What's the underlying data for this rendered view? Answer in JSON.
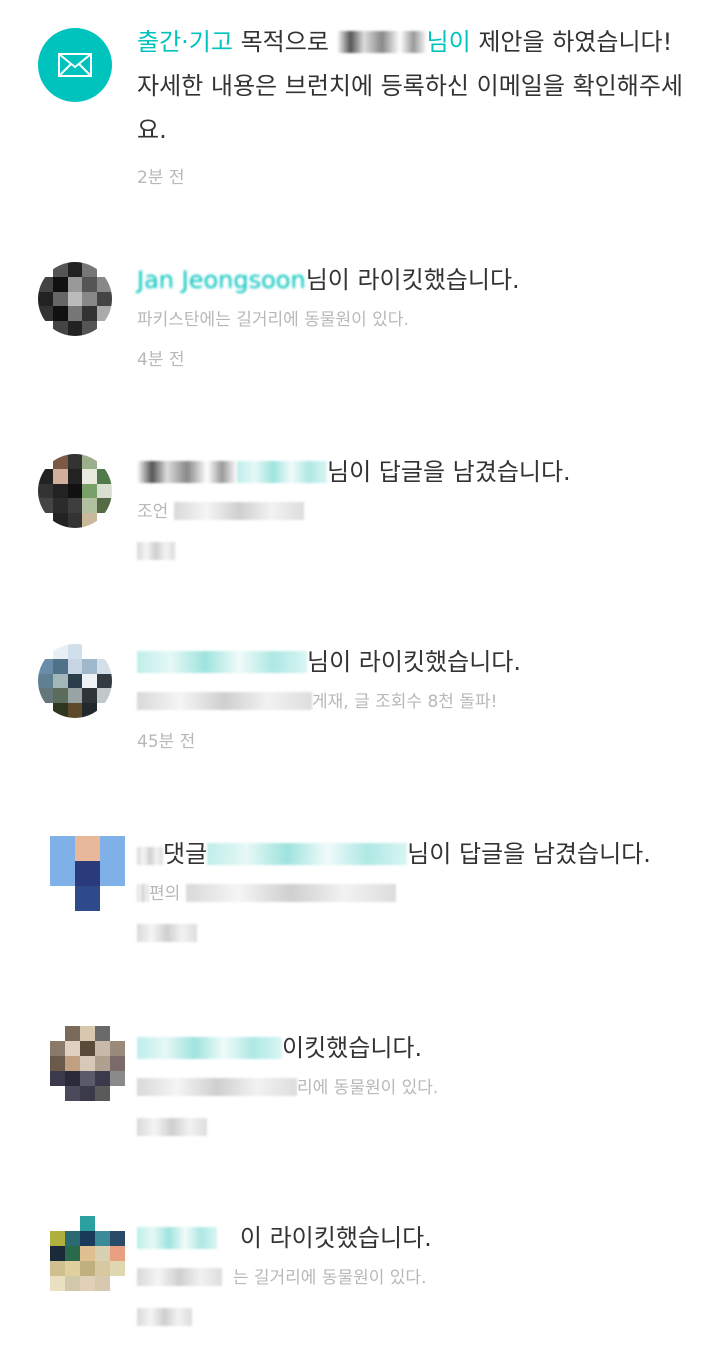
{
  "notifications": [
    {
      "highlight": "출간·기고",
      "text_before_name": " 목적으로 ",
      "name_tail": "님이",
      "text": " 제안을 하였습니다! 자세한 내용은 브런치에 등록하신 이메일을 확인해주세요.",
      "time": "2분 전",
      "icon": "mail-icon"
    },
    {
      "name": "Jan Jeongsoon",
      "action": "님이 라이킷했습니다.",
      "subtitle": "파키스탄에는 길거리에 동물원이 있다.",
      "time": "4분 전"
    },
    {
      "action": "님이 답글을 남겼습니다.",
      "subtitle": "조언",
      "time": ""
    },
    {
      "action": "님이 라이킷했습니다.",
      "subtitle": "게재, 글 조회수 8천 돌파!",
      "time": "45분 전"
    },
    {
      "prefix": "댓글",
      "action": "님이 답글을 남겼습니다.",
      "subtitle": "편의",
      "time": ""
    },
    {
      "action": "이킷했습니다.",
      "subtitle": "리에 동물원이 있다.",
      "time": ""
    },
    {
      "action": "이 라이킷했습니다.",
      "subtitle": "는 길거리에 동물원이 있다.",
      "time": ""
    }
  ],
  "colors": {
    "accent": "#00c3bd",
    "text": "#333333",
    "muted": "#b8b8b8"
  }
}
